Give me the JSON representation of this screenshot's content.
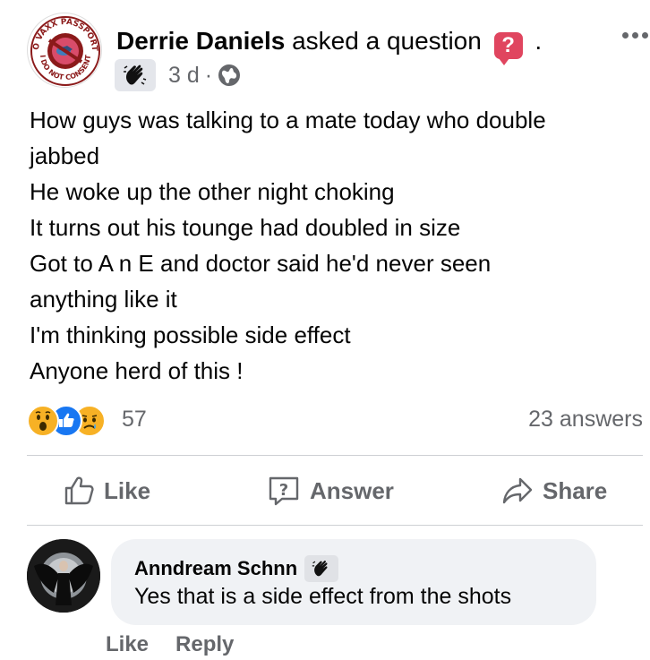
{
  "post": {
    "author": "Derrie Daniels",
    "action": "asked a question",
    "question_badge": "?",
    "trailing_dot": ".",
    "time": "3 d",
    "time_separator": "·",
    "body_lines": [
      "How guys was talking to a mate today who double",
      "jabbed",
      "He woke up the other night choking",
      "It turns out his tounge had doubled in size",
      "Got to A n E and doctor said he'd never seen",
      "anything like it",
      "I'm thinking possible side effect",
      "Anyone herd of this !"
    ],
    "avatar_badge_text": {
      "top": "NO VAXX PASSPORTS",
      "bottom": "I DO NOT CONSENT"
    },
    "icons": [
      "wave-badge-icon",
      "globe-icon",
      "more-options-icon"
    ]
  },
  "reactions": {
    "count": "57",
    "types": [
      "wow",
      "like",
      "sad"
    ],
    "answers": "23 answers"
  },
  "actions": {
    "like": "Like",
    "answer": "Answer",
    "share": "Share"
  },
  "comment": {
    "author": "Anndream Schnn",
    "text": "Yes that is a side effect from the shots",
    "like": "Like",
    "reply": "Reply"
  },
  "colors": {
    "text": "#050505",
    "secondary": "#65676b",
    "question_badge": "#e0455f",
    "like_blue": "#1877f2",
    "reaction_yellow": "#f7b125",
    "bubble": "#f0f2f5",
    "divider": "#ced0d4"
  }
}
